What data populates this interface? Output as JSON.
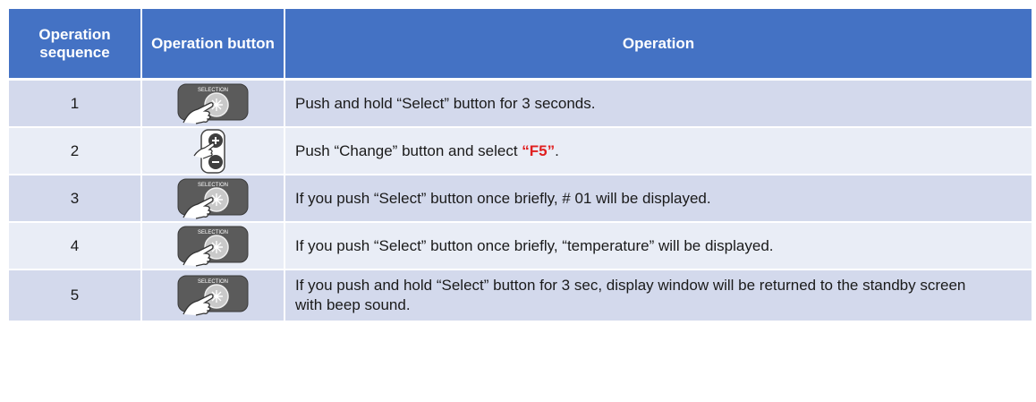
{
  "table": {
    "headers": {
      "sequence": "Operation sequence",
      "button": "Operation button",
      "operation": "Operation"
    },
    "rows": [
      {
        "sequence": "1",
        "button_icon": "selection-button-icon",
        "button_icon_label": "SELECTION",
        "operation_text": "Push and hold “Select” button for 3 seconds.",
        "highlight": ""
      },
      {
        "sequence": "2",
        "button_icon": "change-plus-minus-button-icon",
        "operation_text": "Push “Change” button and select ",
        "highlight": "“F5”",
        "operation_suffix": "."
      },
      {
        "sequence": "3",
        "button_icon": "selection-button-icon",
        "button_icon_label": "SELECTION",
        "operation_text": "If you push “Select” button once briefly, # 01 will be displayed.",
        "highlight": ""
      },
      {
        "sequence": "4",
        "button_icon": "selection-button-icon",
        "button_icon_label": "SELECTION",
        "operation_text": "If you push “Select” button once briefly, “temperature” will be displayed.",
        "highlight": ""
      },
      {
        "sequence": "5",
        "button_icon": "selection-button-icon",
        "button_icon_label": "SELECTION",
        "operation_text": "If you push and hold “Select” button for 3 sec, display window will be returned to the standby screen with beep sound.",
        "highlight": ""
      }
    ]
  },
  "colors": {
    "header_bg": "#4472c4",
    "row_odd_bg": "#d3d9ec",
    "row_even_bg": "#e9edf6",
    "highlight_text": "#e02020"
  }
}
